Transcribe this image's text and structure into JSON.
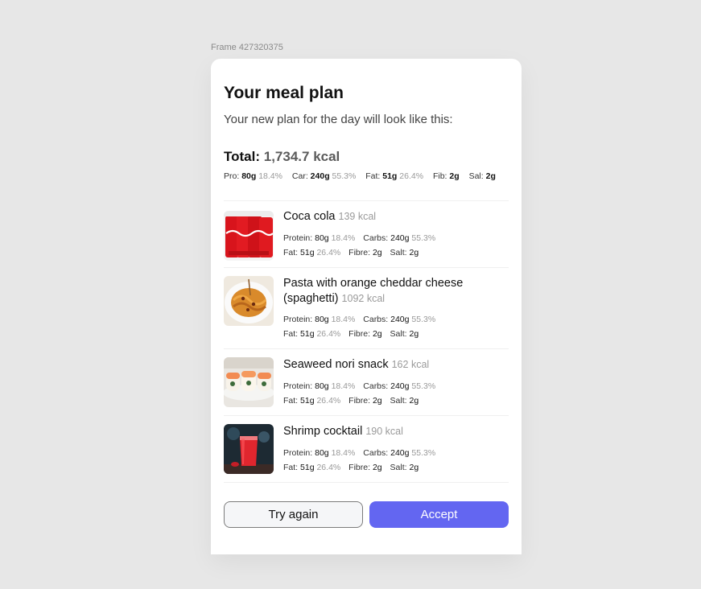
{
  "frame_label": "Frame 427320375",
  "card": {
    "title": "Your meal plan",
    "subtitle": "Your new plan for the day will look like this:",
    "total_label": "Total:",
    "total_kcal": "1,734.7 kcal",
    "macros": {
      "pro_label": "Pro:",
      "pro_val": "80g",
      "pro_pct": "18.4%",
      "car_label": "Car:",
      "car_val": "240g",
      "car_pct": "55.3%",
      "fat_label": "Fat:",
      "fat_val": "51g",
      "fat_pct": "26.4%",
      "fib_label": "Fib:",
      "fib_val": "2g",
      "sal_label": "Sal:",
      "sal_val": "2g"
    }
  },
  "items": [
    {
      "name": "Coca cola",
      "kcal": "139 kcal",
      "protein_label": "Protein:",
      "protein": "80g",
      "protein_pct": "18.4%",
      "carbs_label": "Carbs:",
      "carbs": "240g",
      "carbs_pct": "55.3%",
      "fat_label": "Fat:",
      "fat": "51g",
      "fat_pct": "26.4%",
      "fibre_label": "Fibre:",
      "fibre": "2g",
      "salt_label": "Salt:",
      "salt": "2g",
      "image": "coca-cola-cans"
    },
    {
      "name": "Pasta with orange cheddar cheese (spaghetti)",
      "kcal": "1092 kcal",
      "protein_label": "Protein:",
      "protein": "80g",
      "protein_pct": "18.4%",
      "carbs_label": "Carbs:",
      "carbs": "240g",
      "carbs_pct": "55.3%",
      "fat_label": "Fat:",
      "fat": "51g",
      "fat_pct": "26.4%",
      "fibre_label": "Fibre:",
      "fibre": "2g",
      "salt_label": "Salt:",
      "salt": "2g",
      "image": "pasta-plate"
    },
    {
      "name": "Seaweed nori snack",
      "kcal": "162 kcal",
      "protein_label": "Protein:",
      "protein": "80g",
      "protein_pct": "18.4%",
      "carbs_label": "Carbs:",
      "carbs": "240g",
      "carbs_pct": "55.3%",
      "fat_label": "Fat:",
      "fat": "51g",
      "fat_pct": "26.4%",
      "fibre_label": "Fibre:",
      "fibre": "2g",
      "salt_label": "Salt:",
      "salt": "2g",
      "image": "sushi-rolls"
    },
    {
      "name": "Shrimp cocktail",
      "kcal": "190 kcal",
      "protein_label": "Protein:",
      "protein": "80g",
      "protein_pct": "18.4%",
      "carbs_label": "Carbs:",
      "carbs": "240g",
      "carbs_pct": "55.3%",
      "fat_label": "Fat:",
      "fat": "51g",
      "fat_pct": "26.4%",
      "fibre_label": "Fibre:",
      "fibre": "2g",
      "salt_label": "Salt:",
      "salt": "2g",
      "image": "red-cocktail-glass"
    }
  ],
  "buttons": {
    "try_again": "Try again",
    "accept": "Accept"
  },
  "colors": {
    "accent": "#6366f1",
    "background": "#e7e7e7",
    "card": "#ffffff"
  }
}
